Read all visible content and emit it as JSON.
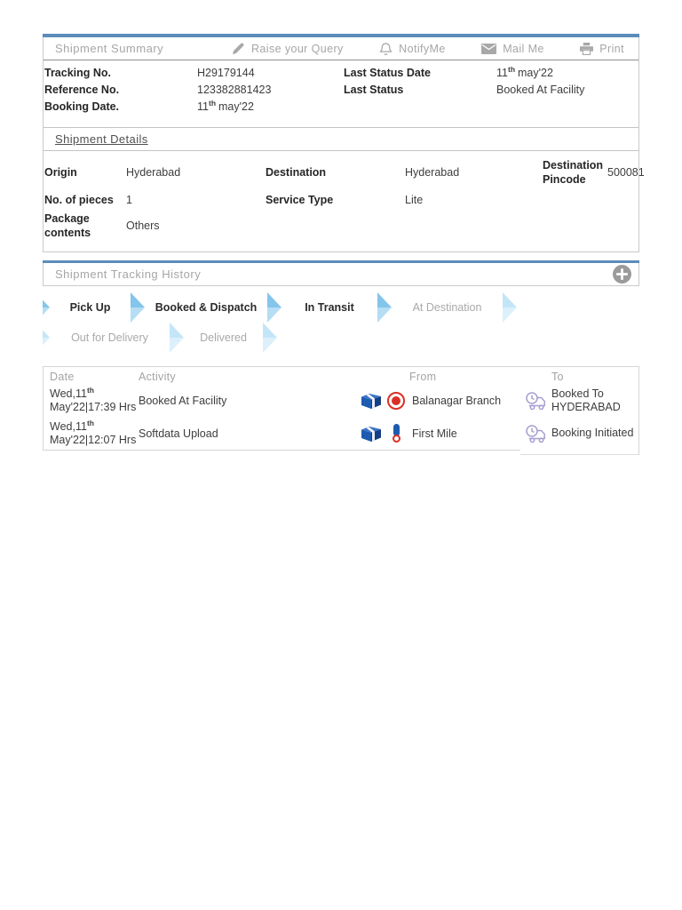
{
  "colors": {
    "accent_bar": "#5b8cba",
    "chevron_active": "#84c5eb",
    "chevron_inactive": "#c3e5f8",
    "package_blue": "#1d5bb0",
    "status_red": "#d93025",
    "truck_purple": "#a79fd0",
    "muted_text": "#a6a6a6"
  },
  "summary": {
    "title": "Shipment Summary",
    "actions": [
      {
        "label": "Raise your Query",
        "icon": "pencil-icon"
      },
      {
        "label": "NotifyMe",
        "icon": "bell-icon"
      },
      {
        "label": "Mail Me",
        "icon": "mail-icon"
      },
      {
        "label": "Print",
        "icon": "print-icon"
      }
    ],
    "fields": {
      "tracking_label": "Tracking No.",
      "tracking_value": "H29179144",
      "reference_label": "Reference No.",
      "reference_value": "123382881423",
      "booking_label": "Booking Date.",
      "booking_day": "11",
      "booking_sup": "th",
      "booking_rest": "may'22",
      "last_status_date_label": "Last Status Date",
      "last_status_date_day": "11",
      "last_status_date_sup": "th",
      "last_status_date_rest": "may'22",
      "last_status_label": "Last Status",
      "last_status_value": "Booked At Facility"
    }
  },
  "details": {
    "title": "Shipment Details",
    "origin_label": "Origin",
    "origin_value": "Hyderabad",
    "destination_label": "Destination",
    "destination_value": "Hyderabad",
    "pincode_label": "Destination Pincode",
    "pincode_value": "500081",
    "pieces_label": "No. of pieces",
    "pieces_value": "1",
    "service_label": "Service Type",
    "service_value": "Lite",
    "package_label": "Package contents",
    "package_value": "Others"
  },
  "tracking": {
    "title": "Shipment Tracking History",
    "add_icon": "plus-icon",
    "steps": [
      {
        "label": "Pick Up",
        "state": "done"
      },
      {
        "label": "Booked & Dispatch",
        "state": "done"
      },
      {
        "label": "In Transit",
        "state": "done"
      },
      {
        "label": "At Destination",
        "state": "pending"
      },
      {
        "label": "Out for Delivery",
        "state": "pending"
      },
      {
        "label": "Delivered",
        "state": "pending"
      }
    ],
    "table": {
      "headers": {
        "date": "Date",
        "activity": "Activity",
        "from": "From",
        "to": "To"
      },
      "rows": [
        {
          "date_line1": "Wed,11",
          "date_sup": "th",
          "date_line2": "May'22|17:39 Hrs",
          "activity": "Booked At Facility",
          "from_icon": "package-icon",
          "from_status_icon": "red-target-icon",
          "from": "Balanagar Branch",
          "to_icon": "truck-clock-icon",
          "to_line1": "Booked To",
          "to_line2": "HYDERABAD"
        },
        {
          "date_line1": "Wed,11",
          "date_sup": "th",
          "date_line2": "May'22|12:07 Hrs",
          "activity": "Softdata Upload",
          "from_icon": "package-icon",
          "from_status_icon": "blue-pin-icon",
          "from": "First Mile",
          "to_icon": "truck-clock-icon",
          "to_line1": "Booking Initiated",
          "to_line2": ""
        }
      ]
    }
  }
}
